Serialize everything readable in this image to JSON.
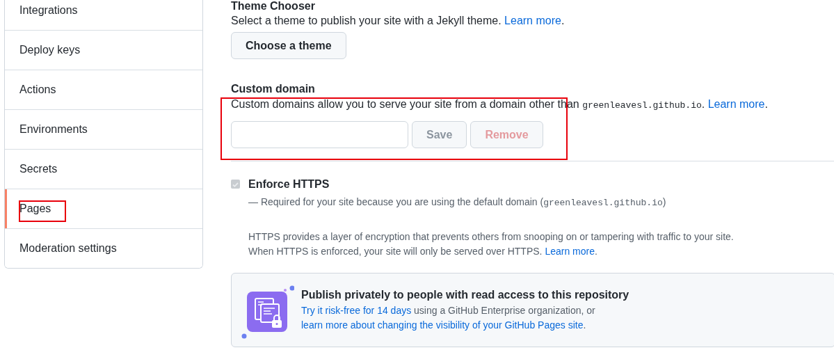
{
  "sidebar": {
    "items": [
      {
        "label": "Integrations",
        "selected": false,
        "highlighted": false
      },
      {
        "label": "Deploy keys",
        "selected": false,
        "highlighted": false
      },
      {
        "label": "Actions",
        "selected": false,
        "highlighted": false
      },
      {
        "label": "Environments",
        "selected": false,
        "highlighted": false
      },
      {
        "label": "Secrets",
        "selected": false,
        "highlighted": false
      },
      {
        "label": "Pages",
        "selected": true,
        "highlighted": true
      },
      {
        "label": "Moderation settings",
        "selected": false,
        "highlighted": false
      }
    ]
  },
  "theme_chooser": {
    "heading": "Theme Chooser",
    "description": "Select a theme to publish your site with a Jekyll theme.",
    "link": "Learn more",
    "trailing": ".",
    "button": "Choose a theme"
  },
  "custom_domain": {
    "heading": "Custom domain",
    "description": "Custom domains allow you to serve your site from a domain other than",
    "domain": "greenleavesl.github.io",
    "after_domain": ".",
    "link": "Learn more",
    "trailing": ".",
    "highlighted": true,
    "buttons": [
      {
        "label": "Save",
        "kind": "secondary",
        "disabled": true
      },
      {
        "label": "Remove",
        "kind": "danger",
        "disabled": true
      }
    ]
  },
  "enforce_https": {
    "label": "Enforce HTTPS",
    "checked": true,
    "disabled": true,
    "note": "— Required for your site because you are using the default domain (",
    "domain": "greenleavesl.github.io",
    "note_end": ")",
    "info": "HTTPS provides a layer of encryption that prevents others from snooping on or tampering with traffic to your site.",
    "info_2": "When HTTPS is enforced, your site will only be served over HTTPS.",
    "link": "Learn more",
    "trailing": "."
  },
  "callout": {
    "title": "Publish privately to people with read access to this repository",
    "link": "Try it risk-free for 14 days",
    "text": " using a GitHub Enterprise organization, or ",
    "link_2": "learn more about changing the visibility of your GitHub Pages site",
    "trailing": "."
  }
}
